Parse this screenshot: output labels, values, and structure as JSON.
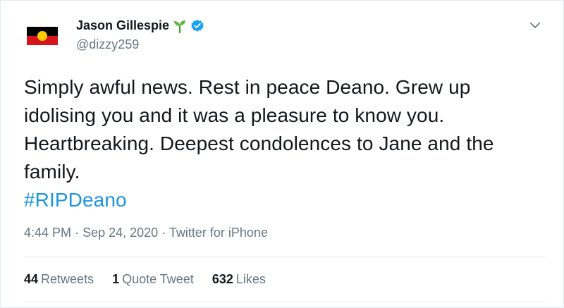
{
  "author": {
    "name": "Jason Gillespie",
    "handle": "@dizzy259",
    "name_emoji": "seedling-icon",
    "verified_icon": "verified-badge-icon"
  },
  "tweet": {
    "lines": [
      "Simply awful news. Rest in peace Deano. Grew up",
      "idolising you and it was a pleasure to know you.",
      "Heartbreaking. Deepest condolences to Jane and the",
      "family."
    ],
    "hashtag": "#RIPDeano"
  },
  "meta": {
    "time": "4:44 PM",
    "date": "Sep 24, 2020",
    "source": "Twitter for iPhone",
    "separator": "·"
  },
  "stats": {
    "retweets_count": "44",
    "retweets_label": "Retweets",
    "quotes_count": "1",
    "quotes_label": "Quote Tweet",
    "likes_count": "632",
    "likes_label": "Likes"
  },
  "colors": {
    "link": "#1b95e0",
    "verified": "#1da1f2",
    "muted": "#657786",
    "text": "#14171a",
    "divider": "#e6ecf0"
  }
}
